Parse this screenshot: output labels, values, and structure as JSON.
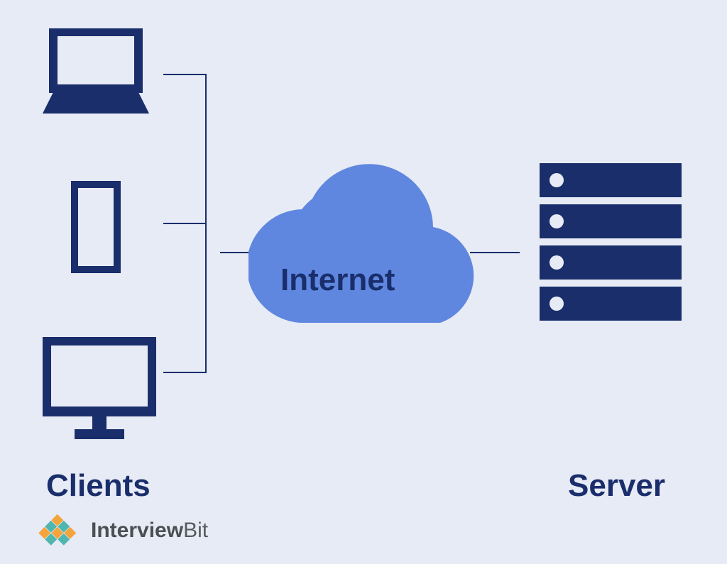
{
  "diagram": {
    "clients_label": "Clients",
    "internet_label": "Internet",
    "server_label": "Server",
    "nodes": {
      "clients": [
        "laptop",
        "smartphone",
        "desktop-monitor"
      ],
      "middle": "internet-cloud",
      "server": "server-rack"
    },
    "connections": [
      [
        "clients",
        "internet-cloud"
      ],
      [
        "internet-cloud",
        "server-rack"
      ]
    ]
  },
  "branding": {
    "name_prefix": "Interview",
    "name_suffix": "Bit"
  },
  "colors": {
    "navy": "#1a2e6b",
    "cloud": "#5f87e0",
    "bg": "#e7ebf5",
    "logo_teal": "#4fb6b0",
    "logo_orange": "#f3a53c"
  }
}
